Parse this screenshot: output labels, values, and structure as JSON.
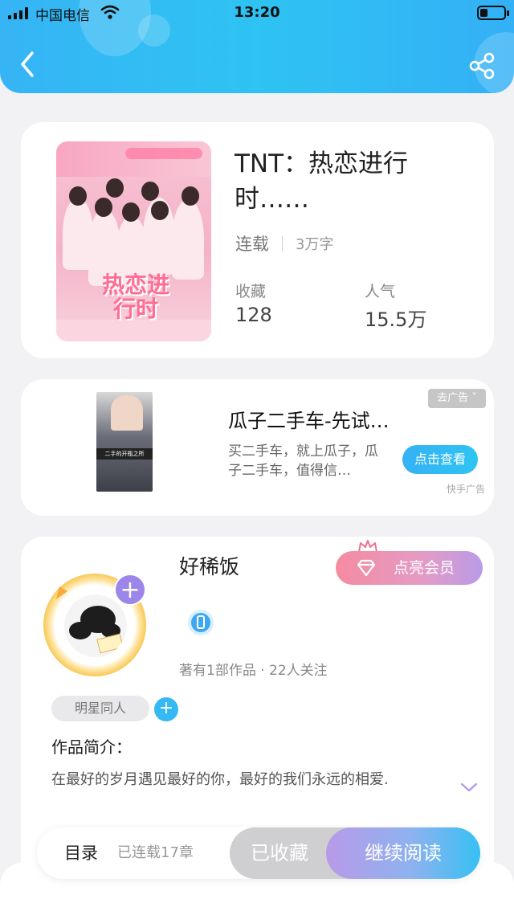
{
  "status_bar": {
    "carrier": "中国电信",
    "time": "13:20"
  },
  "header": {
    "back_icon": "chevron-left-icon",
    "share_icon": "share-icon"
  },
  "book": {
    "title": "TNT：热恋进行时……",
    "cover_title": "热恋进行时",
    "status": "连载",
    "word_count": "3万字",
    "favorites_label": "收藏",
    "favorites_value": "128",
    "popularity_label": "人气",
    "popularity_value": "15.5万"
  },
  "ad": {
    "title": "瓜子二手车-先试…",
    "description": "买二手车，就上瓜子，瓜子二手车，值得信…",
    "close_label": "去广告",
    "cta_label": "点击查看",
    "source": "快手广告",
    "image_caption": "二手的开瓶之所"
  },
  "author": {
    "name": "好稀饭",
    "vip_label": "点亮会员",
    "stats": "著有1部作品 · 22人关注",
    "tag": "明星同人",
    "intro_label": "作品简介：",
    "intro_text": "在最好的岁月遇见最好的你，最好的我们永远的相爱."
  },
  "bottom_bar": {
    "toc_label": "目录",
    "chapters": "已连载17章",
    "favorited_label": "已收藏",
    "read_label": "继续阅读"
  },
  "colors": {
    "header_gradient": [
      "#36b4f5",
      "#2ec3f2"
    ],
    "accent_blue": "#34b9f3",
    "vip_gradient": [
      "#f58ba0",
      "#b99be8"
    ],
    "read_gradient": [
      "#b89ae8",
      "#37c0f3"
    ]
  }
}
